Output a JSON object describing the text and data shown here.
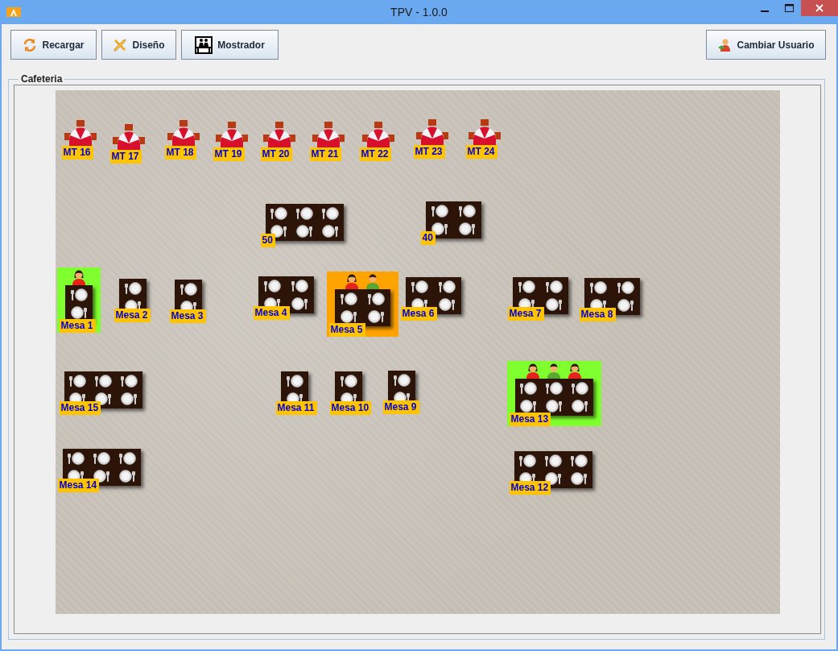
{
  "window": {
    "title": "TPV - 1.0.0"
  },
  "toolbar": {
    "buttons": [
      {
        "label": "Recargar",
        "kind": "reload"
      },
      {
        "label": "Diseño",
        "kind": "design"
      },
      {
        "label": "Mostrador",
        "kind": "counter"
      }
    ],
    "user_button": {
      "label": "Cambiar Usuario"
    }
  },
  "room": {
    "title": "Cafeteria",
    "tables": [
      {
        "label": "MT 16",
        "kind": "parasol"
      },
      {
        "label": "MT 17",
        "kind": "parasol"
      },
      {
        "label": "MT 18",
        "kind": "parasol"
      },
      {
        "label": "MT 19",
        "kind": "parasol"
      },
      {
        "label": "MT 20",
        "kind": "parasol"
      },
      {
        "label": "MT 21",
        "kind": "parasol"
      },
      {
        "label": "MT 22",
        "kind": "parasol"
      },
      {
        "label": "MT 23",
        "kind": "parasol"
      },
      {
        "label": "MT 24",
        "kind": "parasol"
      },
      {
        "label": "50",
        "kind": "large"
      },
      {
        "label": "40",
        "kind": "medium"
      },
      {
        "label": "Mesa 1",
        "kind": "small",
        "color": "#80ff2e",
        "guests": [
          {
            "kind": "woman"
          }
        ]
      },
      {
        "label": "Mesa 2",
        "kind": "small"
      },
      {
        "label": "Mesa 3",
        "kind": "small"
      },
      {
        "label": "Mesa 4",
        "kind": "medium"
      },
      {
        "label": "Mesa 5",
        "kind": "medium",
        "color": "#ffa300",
        "guests": [
          {
            "kind": "woman"
          },
          {
            "kind": "man"
          }
        ]
      },
      {
        "label": "Mesa 6",
        "kind": "medium"
      },
      {
        "label": "Mesa 7",
        "kind": "medium"
      },
      {
        "label": "Mesa 8",
        "kind": "medium"
      },
      {
        "label": "Mesa 15",
        "kind": "large"
      },
      {
        "label": "Mesa 11",
        "kind": "small"
      },
      {
        "label": "Mesa 10",
        "kind": "small"
      },
      {
        "label": "Mesa 9",
        "kind": "small"
      },
      {
        "label": "Mesa 13",
        "kind": "large",
        "color": "#80ff2e",
        "guests": [
          {
            "kind": "woman"
          },
          {
            "kind": "man"
          },
          {
            "kind": "woman"
          }
        ]
      },
      {
        "label": "Mesa 14",
        "kind": "large"
      },
      {
        "label": "Mesa 12",
        "kind": "large"
      }
    ]
  }
}
